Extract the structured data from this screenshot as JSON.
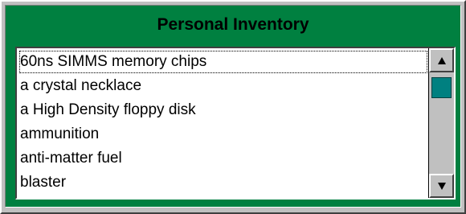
{
  "window": {
    "title": "Personal Inventory"
  },
  "inventory": {
    "items": [
      {
        "label": "60ns SIMMS memory chips"
      },
      {
        "label": "a crystal necklace"
      },
      {
        "label": "a High Density floppy disk"
      },
      {
        "label": "ammunition"
      },
      {
        "label": "anti-matter fuel"
      },
      {
        "label": "blaster"
      }
    ],
    "focused_index": 0,
    "scroll_position_fraction": 0.05
  },
  "scrollbar": {
    "up_icon": "arrow-up-icon",
    "down_icon": "arrow-down-icon"
  },
  "colors": {
    "panel": "#008040",
    "thumb": "#008080",
    "face": "#c0c0c0"
  }
}
